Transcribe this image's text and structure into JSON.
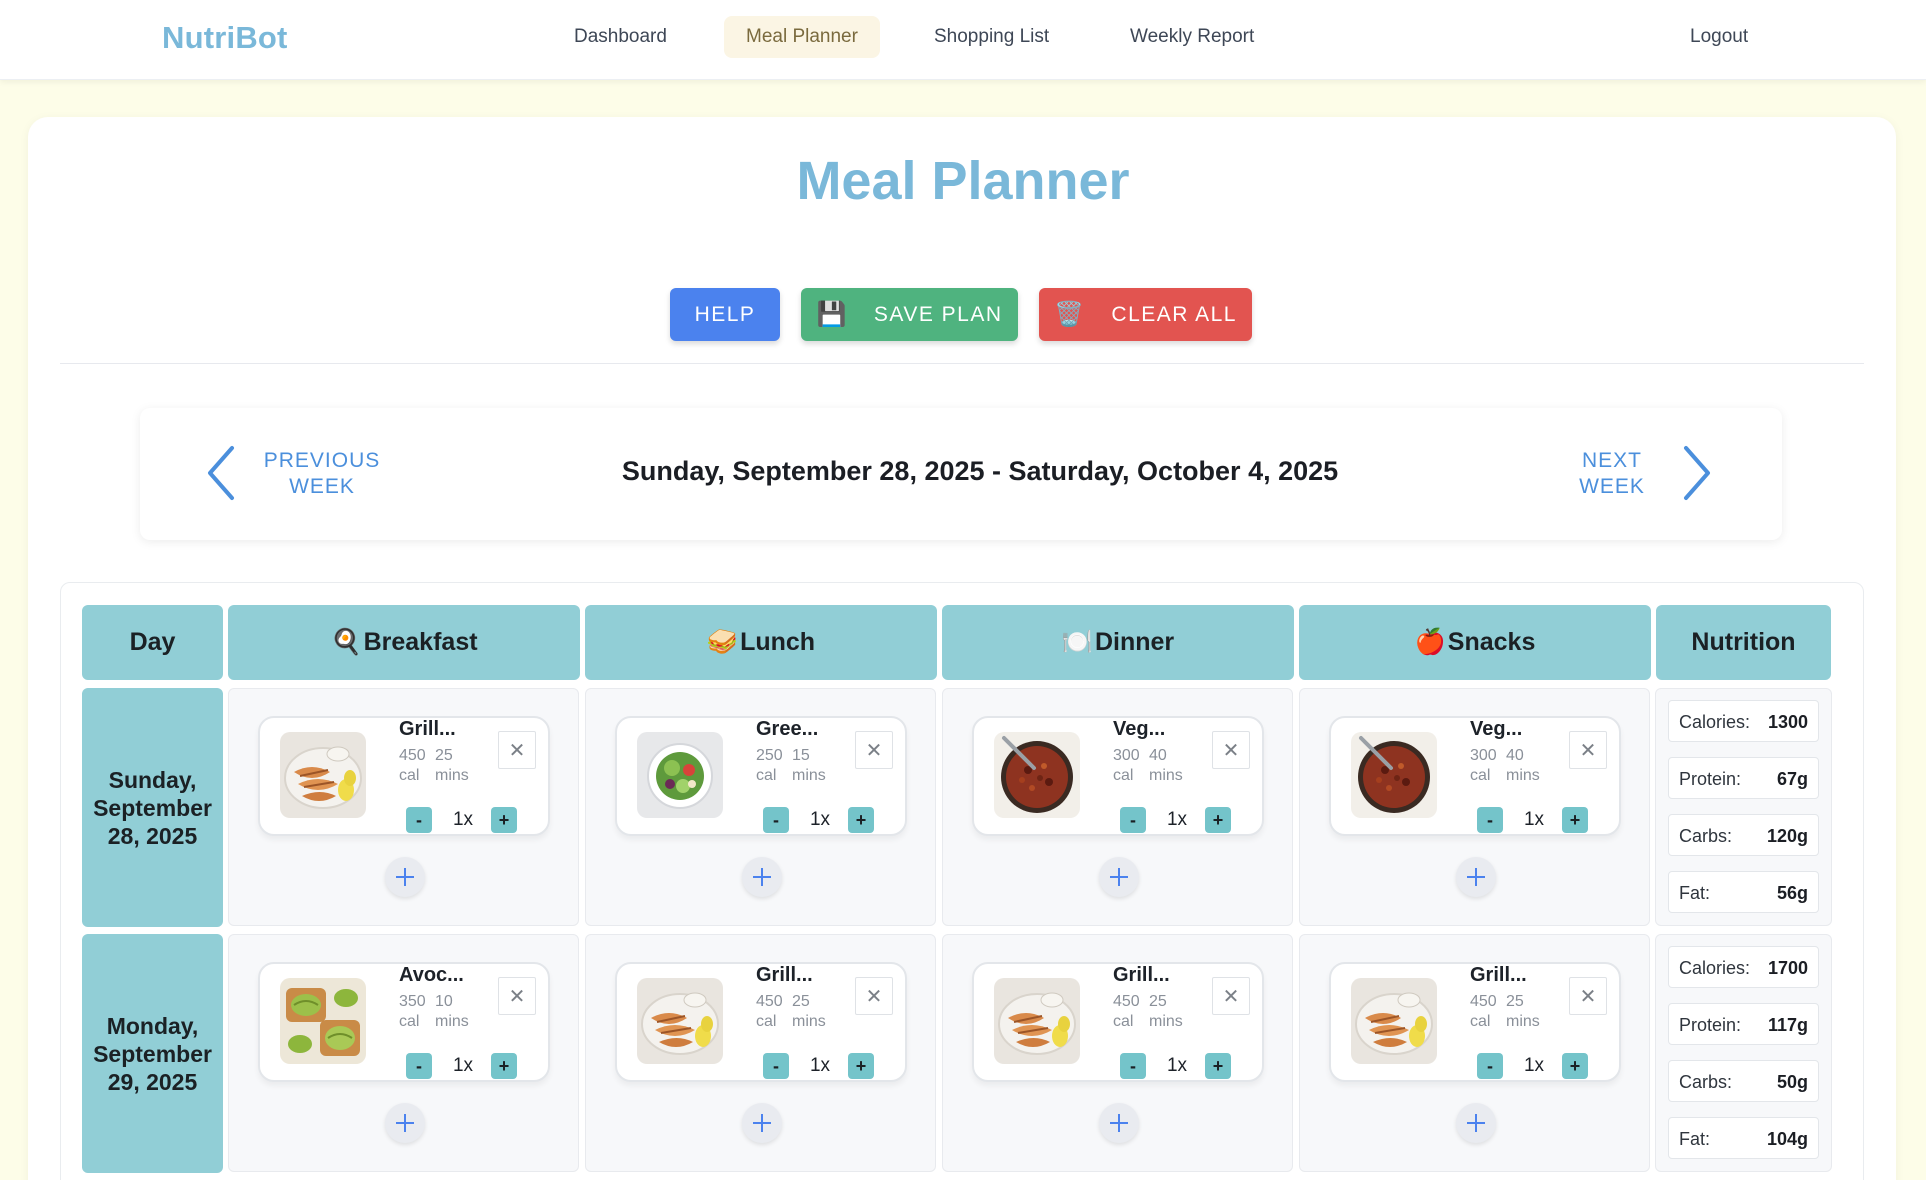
{
  "app": {
    "brand": "NutriBot",
    "nav": [
      {
        "label": "Dashboard"
      },
      {
        "label": "Meal Planner",
        "active": true
      },
      {
        "label": "Shopping List"
      },
      {
        "label": "Weekly Report"
      }
    ],
    "logout": "Logout"
  },
  "page": {
    "title": "Meal Planner",
    "actions": {
      "help": "HELP",
      "save": "SAVE PLAN",
      "save_icon": "💾",
      "clear": "CLEAR ALL",
      "clear_icon": "🗑️"
    }
  },
  "week": {
    "prev_line1": "PREVIOUS",
    "prev_line2": "WEEK",
    "next_line1": "NEXT",
    "next_line2": "WEEK",
    "range": "Sunday, September 28, 2025 - Saturday, October 4, 2025"
  },
  "headers": {
    "day": "Day",
    "breakfast": "Breakfast",
    "breakfast_icon": "🍳",
    "lunch": "Lunch",
    "lunch_icon": "🥪",
    "dinner": "Dinner",
    "dinner_icon": "🍽️",
    "snacks": "Snacks",
    "snacks_icon": "🍎",
    "nutrition": "Nutrition"
  },
  "days": [
    {
      "line1": "Sunday,",
      "line2": "September",
      "line3": "28, 2025",
      "meals": [
        {
          "name": "Grill...",
          "cal": "450",
          "cal_unit": "cal",
          "mins": "25",
          "mins_unit": "mins",
          "qty": "1x",
          "image": "grilled-chicken"
        },
        {
          "name": "Gree...",
          "cal": "250",
          "cal_unit": "cal",
          "mins": "15",
          "mins_unit": "mins",
          "qty": "1x",
          "image": "green-salad"
        },
        {
          "name": "Veg...",
          "cal": "300",
          "cal_unit": "cal",
          "mins": "40",
          "mins_unit": "mins",
          "qty": "1x",
          "image": "veggie-chili"
        },
        {
          "name": "Veg...",
          "cal": "300",
          "cal_unit": "cal",
          "mins": "40",
          "mins_unit": "mins",
          "qty": "1x",
          "image": "veggie-chili"
        }
      ],
      "nutrition": [
        {
          "label": "Calories:",
          "value": "1300"
        },
        {
          "label": "Protein:",
          "value": "67g"
        },
        {
          "label": "Carbs:",
          "value": "120g"
        },
        {
          "label": "Fat:",
          "value": "56g"
        }
      ]
    },
    {
      "line1": "Monday,",
      "line2": "September",
      "line3": "29, 2025",
      "meals": [
        {
          "name": "Avoc...",
          "cal": "350",
          "cal_unit": "cal",
          "mins": "10",
          "mins_unit": "mins",
          "qty": "1x",
          "image": "avocado-toast"
        },
        {
          "name": "Grill...",
          "cal": "450",
          "cal_unit": "cal",
          "mins": "25",
          "mins_unit": "mins",
          "qty": "1x",
          "image": "grilled-chicken"
        },
        {
          "name": "Grill...",
          "cal": "450",
          "cal_unit": "cal",
          "mins": "25",
          "mins_unit": "mins",
          "qty": "1x",
          "image": "grilled-chicken"
        },
        {
          "name": "Grill...",
          "cal": "450",
          "cal_unit": "cal",
          "mins": "25",
          "mins_unit": "mins",
          "qty": "1x",
          "image": "grilled-chicken"
        }
      ],
      "nutrition": [
        {
          "label": "Calories:",
          "value": "1700"
        },
        {
          "label": "Protein:",
          "value": "117g"
        },
        {
          "label": "Carbs:",
          "value": "50g"
        },
        {
          "label": "Fat:",
          "value": "104g"
        }
      ]
    }
  ],
  "colors": {
    "brand": "#7ab8d9",
    "help": "#4b82ee",
    "save": "#4fb37f",
    "clear": "#e25450",
    "header_teal": "#91ced6",
    "qty_teal": "#74c4ca",
    "link_blue": "#4b8fdc"
  }
}
